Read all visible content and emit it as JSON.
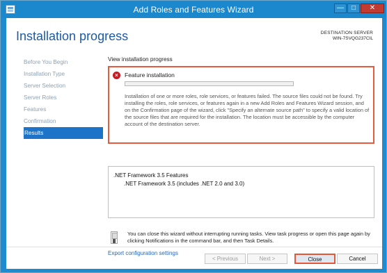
{
  "window": {
    "title": "Add Roles and Features Wizard",
    "controls": {
      "minimize": "—",
      "maximize": "□",
      "close": "✕"
    }
  },
  "header": {
    "page_title": "Installation progress",
    "destination_label": "DESTINATION SERVER",
    "destination_value": "WIN-7SVQG237CIL"
  },
  "sidebar": {
    "items": [
      {
        "label": "Before You Begin"
      },
      {
        "label": "Installation Type"
      },
      {
        "label": "Server Selection"
      },
      {
        "label": "Server Roles"
      },
      {
        "label": "Features"
      },
      {
        "label": "Confirmation"
      },
      {
        "label": "Results"
      }
    ]
  },
  "progress_section": {
    "label": "View installation progress",
    "status_title": "Feature installation",
    "progress_fraction": 0,
    "message": "Installation of one or more roles, role services, or features failed. The source files could not be found. Try installing the roles, role services, or features again in a new Add Roles and Features Wizard session, and on the Confirmation page of the wizard, click \"Specify an alternate source path\" to specify a valid location of the source files that are required for the installation. The location must be accessible by the computer account of the destination server."
  },
  "results": {
    "feature": ".NET Framework 3.5 Features",
    "subfeature": ".NET Framework 3.5 (includes .NET 2.0 and 3.0)"
  },
  "info": {
    "text": "You can close this wizard without interrupting running tasks. View task progress or open this page again by clicking Notifications in the command bar, and then Task Details."
  },
  "links": {
    "export": "Export configuration settings"
  },
  "buttons": {
    "previous": "< Previous",
    "next": "Next >",
    "close": "Close",
    "cancel": "Cancel"
  },
  "colors": {
    "titlebar": "#1b87cd",
    "heading": "#1d5aa8",
    "selected_nav": "#1d73c7",
    "error": "#c91a23",
    "highlight_border": "#e65b3d",
    "link": "#2866b1"
  },
  "icons": {
    "app": "server-manager-icon",
    "error": "error-x-icon",
    "info": "notification-document-icon"
  }
}
